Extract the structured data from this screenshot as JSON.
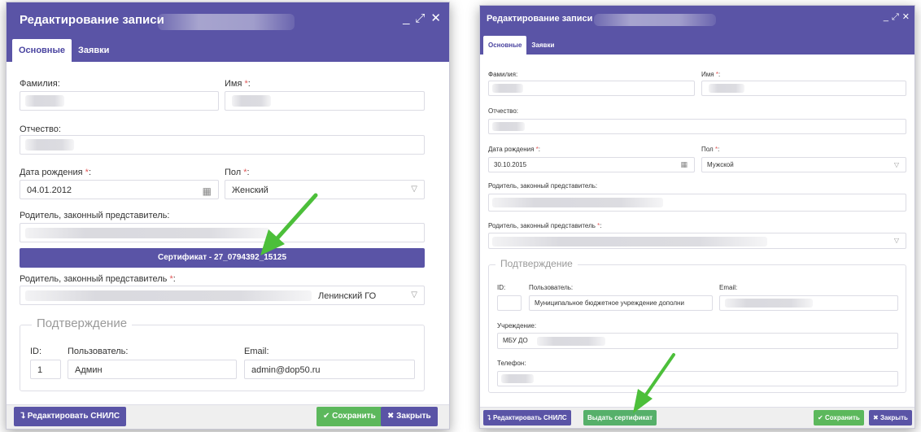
{
  "left_dialog": {
    "title": "Редактирование записи",
    "window_controls": {
      "minimize": "_",
      "maximize": "⤢",
      "close": "✕"
    },
    "tabs": [
      "Основные",
      "Заявки"
    ],
    "surname_label": "Фамилия:",
    "name_label": "Имя",
    "patronymic_label": "Отчество:",
    "birthdate_label": "Дата рождения",
    "birthdate_value": "04.01.2012",
    "gender_label": "Пол",
    "gender_value": "Женский",
    "parent_label": "Родитель, законный представитель:",
    "certificate_label": "Сертификат - 27_0794392_15125",
    "parent_req_label": "Родитель, законный представитель",
    "parent_req_value": "Ленинский ГО",
    "confirmation_legend": "Подтверждение",
    "id_label": "ID:",
    "id_value": "1",
    "user_label": "Пользователь:",
    "user_value": "Админ",
    "email_label": "Email:",
    "email_value": "admin@dop50.ru",
    "footer": {
      "edit_snils": "Редактировать СНИЛС",
      "save": "Сохранить",
      "close": "Закрыть"
    }
  },
  "right_dialog": {
    "title": "Редактирование записи",
    "window_controls": {
      "minimize": "_",
      "maximize": "⤢",
      "close": "✕"
    },
    "tabs": [
      "Основные",
      "Заявки"
    ],
    "surname_label": "Фамилия:",
    "name_label": "Имя",
    "patronymic_label": "Отчество:",
    "birthdate_label": "Дата рождения",
    "birthdate_value": "30.10.2015",
    "gender_label": "Пол",
    "gender_value": "Мужской",
    "parent_label": "Родитель, законный представитель:",
    "parent_req_label": "Родитель, законный представитель",
    "confirmation_legend": "Подтверждение",
    "id_label": "ID:",
    "user_label": "Пользователь:",
    "user_value": "Муниципальное бюджетное учреждение дополни",
    "email_label": "Email:",
    "institution_label": "Учреждение:",
    "institution_value": "МБУ ДО",
    "phone_label": "Телефон:",
    "footer": {
      "edit_snils": "Редактировать СНИЛС",
      "issue_certificate": "Выдать сертификат",
      "save": "Сохранить",
      "close": "Закрыть"
    }
  },
  "colors": {
    "accent": "#5a54a6",
    "green": "#5cb85c",
    "arrow": "#4cbf3a",
    "required": "#e05a5a"
  },
  "icons": [
    "calendar-icon",
    "dropdown-caret-icon",
    "check-icon",
    "close-icon",
    "edit-snils-icon",
    "annotation-arrow"
  ]
}
